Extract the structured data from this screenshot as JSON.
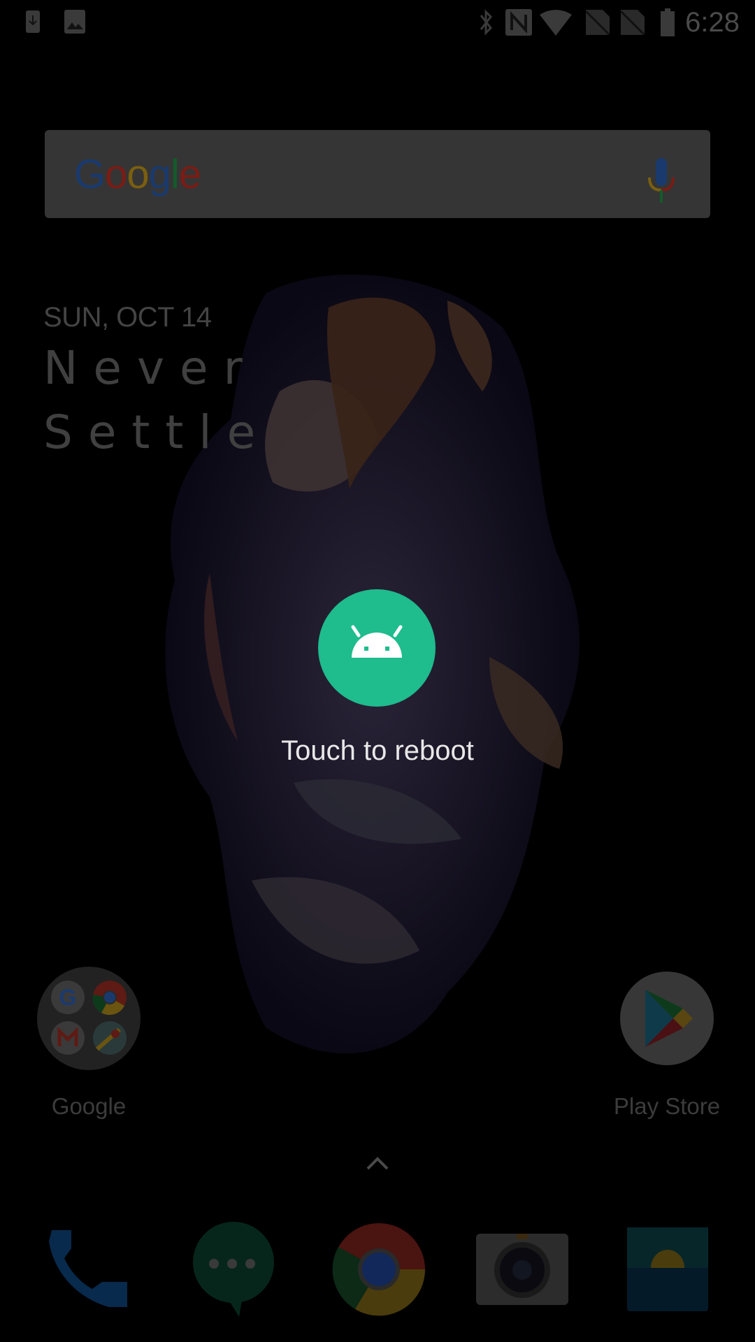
{
  "status_bar": {
    "time": "6:28",
    "left_icons": [
      "download-notification-icon",
      "image-notification-icon"
    ],
    "right_icons": [
      "bluetooth-icon",
      "nfc-icon",
      "wifi-icon",
      "no-sim-icon",
      "no-sim-icon",
      "battery-icon"
    ]
  },
  "search_widget": {
    "logo_letters": [
      {
        "char": "G",
        "color": "#1a3a6e"
      },
      {
        "char": "o",
        "color": "#7a1c15"
      },
      {
        "char": "o",
        "color": "#7a5f10"
      },
      {
        "char": "g",
        "color": "#1a3a6e"
      },
      {
        "char": "l",
        "color": "#145a2a"
      },
      {
        "char": "e",
        "color": "#7a1c15"
      }
    ],
    "mic_icon": "microphone-icon"
  },
  "clock_widget": {
    "date": "SUN, OCT 14",
    "slogan_line1": "Never",
    "slogan_line2": "Settle"
  },
  "reboot_overlay": {
    "icon": "android-icon",
    "label": "Touch to reboot",
    "accent_color": "#1fbc8d"
  },
  "home_apps": [
    {
      "label": "Google",
      "type": "folder",
      "contents": [
        "Google",
        "Chrome",
        "Gmail",
        "Maps"
      ]
    },
    {
      "label": "Play Store",
      "type": "app"
    }
  ],
  "app_drawer_handle": "chevron-up-icon",
  "dock": [
    {
      "name": "Phone",
      "icon": "phone-icon"
    },
    {
      "name": "Hangouts",
      "icon": "chat-bubble-icon"
    },
    {
      "name": "Chrome",
      "icon": "chrome-icon"
    },
    {
      "name": "Camera",
      "icon": "camera-icon"
    },
    {
      "name": "Gallery",
      "icon": "gallery-icon"
    }
  ]
}
